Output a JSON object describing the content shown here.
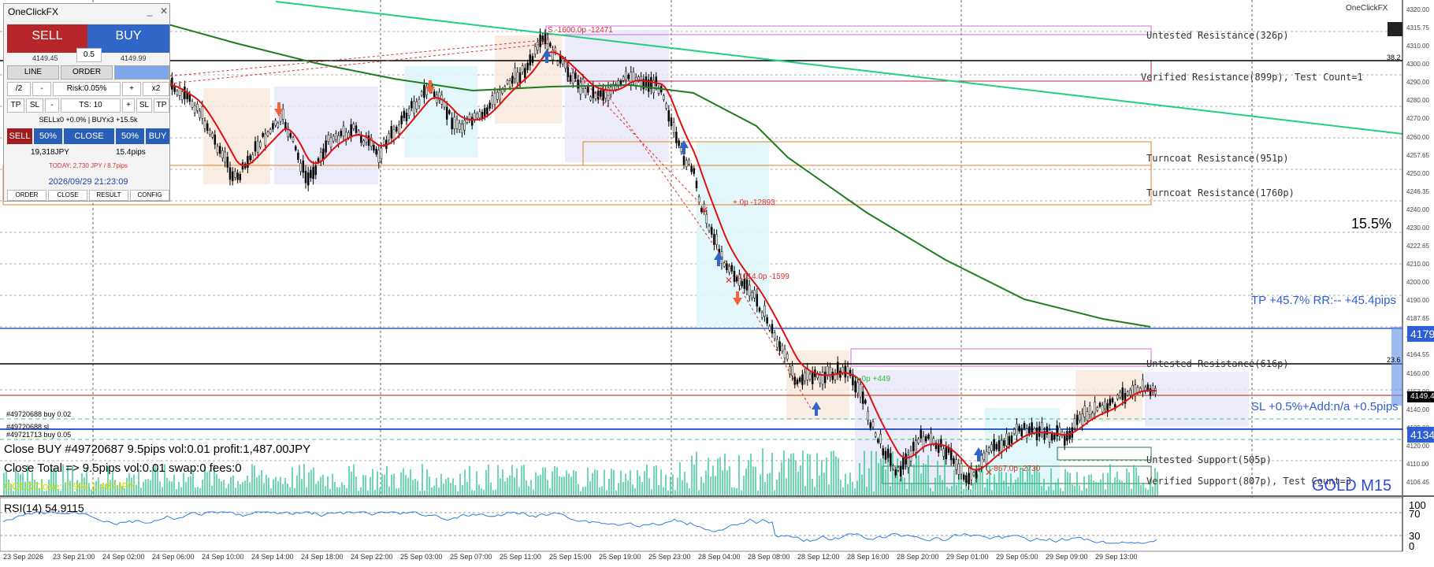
{
  "symbol_label": "GOLD M15",
  "top_right_label": "OneClickFX",
  "percent_label": "15.5%",
  "panel": {
    "title": "OneClickFX",
    "sell_label": "SELL",
    "buy_label": "BUY",
    "lots": "0.5",
    "sell_price": "4149.45",
    "buy_price": "4149.99",
    "line_label": "LINE",
    "order_label": "ORDER",
    "div_label": "/2",
    "minus_label": "-",
    "risk_label": "Risk:0.05%",
    "plus_label": "+",
    "x2_label": "x2",
    "tp_label": "TP",
    "sl_label": "SL",
    "ts_label": "TS: 10",
    "summary": "SELLx0 +0.0% | BUYx3 +15.5k",
    "row_sell": "SELL",
    "row_50a": "50%",
    "row_close": "CLOSE",
    "row_50b": "50%",
    "row_buy": "BUY",
    "profit_jpy": "19,318JPY",
    "profit_pips": "15.4pips",
    "today": "TODAY: 2,730 JPY / 8.7pips",
    "datetime": "2026/09/29  21:23:09",
    "tab_order": "ORDER",
    "tab_close": "CLOSE",
    "tab_result": "RESULT",
    "tab_config": "CONFIG"
  },
  "zones": {
    "untested_res": "Untested Resistance(326p)",
    "verified_res": "Verified Resistance(899p), Test Count=1",
    "turncoat1": "Turncoat Resistance(951p)",
    "turncoat2": "Turncoat Resistance(1760p)",
    "untested_res2": "Untested Resistance(616p)",
    "untested_sup": "Untested Support(505p)",
    "verified_sup": "Verified Support(807p), Test Count=3"
  },
  "tp_text": "TP +45.7% RR:-- +45.4pips",
  "sl_text": "SL +0.5%+Add:n/a +0.5pips",
  "orders": {
    "o1": "#49720688 buy 0.02",
    "o2": "#49720688 sl",
    "o3": "#49721713 buy 0.05"
  },
  "status": {
    "line1": "Close BUY #49720687 9.5pips vol:0.01 profit:1,487.00JPY",
    "line2": "Close Total => 9.5pips vol:0.01 swap:0 fees:0",
    "line3": "GOLDClose: 7.9% 1,487JPY"
  },
  "trade_labels": {
    "t1": "S -1600.0p -12471",
    "t2": "-1014.0p -1599",
    "t3": "-867.0p -2730",
    "t4": "+.0p -12893",
    "t5": "+.0p +449"
  },
  "rsi_label": "RSI(14) 54.9115",
  "rsi_levels": [
    "100",
    "70",
    "30",
    "0"
  ],
  "price_axis": [
    "4320.00",
    "4315.75",
    "4310.00",
    "4300.00",
    "4290.00",
    "4280.00",
    "4270.00",
    "4260.00",
    "4257.65",
    "4250.00",
    "4246.35",
    "4240.00",
    "4230.00",
    "4222.65",
    "4210.00",
    "4200.00",
    "4190.00",
    "4187.65",
    "4170.00",
    "4164.55",
    "4160.00",
    "4153.00",
    "4140.00",
    "4129.00",
    "4120.00",
    "4110.00",
    "4106.45"
  ],
  "price_boxes": {
    "p1": "4179.",
    "p2": "4149.44",
    "p3": "4134.",
    "p4": "38.2",
    "p5": "23.6"
  },
  "time_axis": [
    "23 Sep 2026",
    "23 Sep 21:00",
    "24 Sep 02:00",
    "24 Sep 06:00",
    "24 Sep 10:00",
    "24 Sep 14:00",
    "24 Sep 18:00",
    "24 Sep 22:00",
    "25 Sep 03:00",
    "25 Sep 07:00",
    "25 Sep 11:00",
    "25 Sep 15:00",
    "25 Sep 19:00",
    "25 Sep 23:00",
    "28 Sep 04:00",
    "28 Sep 08:00",
    "28 Sep 12:00",
    "28 Sep 16:00",
    "28 Sep 20:00",
    "29 Sep 01:00",
    "29 Sep 05:00",
    "29 Sep 09:00",
    "29 Sep 13:00"
  ],
  "colors": {
    "bull": "#000000",
    "ema_fast": "#e01010",
    "ema_slow": "#1e7d1e",
    "trend": "#20d080",
    "hline_blue": "#2f5fd0",
    "volume": "#30c890"
  }
}
